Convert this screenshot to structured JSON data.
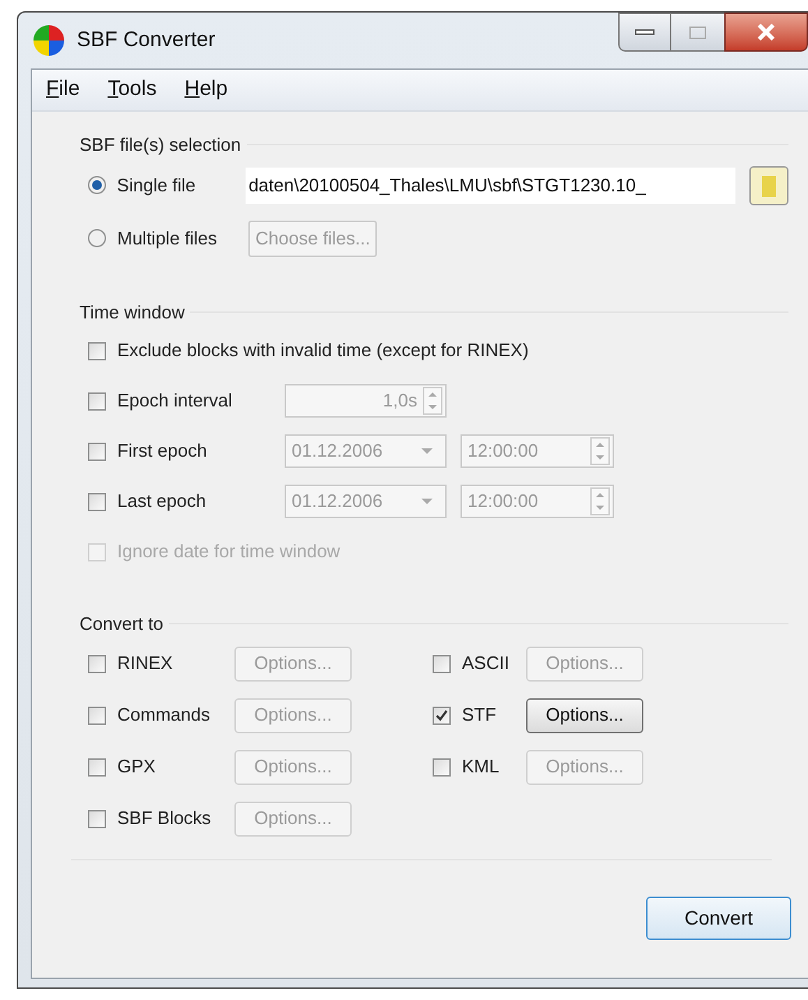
{
  "window": {
    "title": "SBF Converter"
  },
  "menu": [
    {
      "key": "F",
      "rest": "ile"
    },
    {
      "key": "T",
      "rest": "ools"
    },
    {
      "key": "H",
      "rest": "elp"
    }
  ],
  "file_selection": {
    "title": "SBF file(s) selection",
    "options": [
      {
        "label": "Single file",
        "selected": true,
        "kind": "path",
        "value": "daten\\20100504_Thales\\LMU\\sbf\\STGT1230.10_"
      },
      {
        "label": "Multiple files",
        "selected": false,
        "kind": "chooser",
        "button": "Choose files..."
      }
    ]
  },
  "time_window": {
    "title": "Time window",
    "rows": [
      {
        "kind": "plain",
        "label": "Exclude blocks with invalid time (except for RINEX)",
        "checked": false,
        "disabled": false
      },
      {
        "kind": "spin",
        "label": "Epoch interval",
        "checked": false,
        "disabled": false,
        "value": "1,0s"
      },
      {
        "kind": "datetime",
        "label": "First epoch",
        "checked": false,
        "disabled": false,
        "date": "01.12.2006",
        "time": "12:00:00"
      },
      {
        "kind": "datetime",
        "label": "Last epoch",
        "checked": false,
        "disabled": false,
        "date": "01.12.2006",
        "time": "12:00:00"
      },
      {
        "kind": "plain",
        "label": "Ignore date for time window",
        "checked": false,
        "disabled": true
      }
    ]
  },
  "convert_to": {
    "title": "Convert to",
    "left_formats": [
      {
        "label": "RINEX",
        "checked": false,
        "options": "Options..."
      },
      {
        "label": "Commands",
        "checked": false,
        "options": "Options..."
      },
      {
        "label": "GPX",
        "checked": false,
        "options": "Options..."
      },
      {
        "label": "SBF Blocks",
        "checked": false,
        "options": "Options..."
      }
    ],
    "right_formats": [
      {
        "label": "ASCII",
        "checked": false,
        "options": "Options..."
      },
      {
        "label": "STF",
        "checked": true,
        "options": "Options..."
      },
      {
        "label": "KML",
        "checked": false,
        "options": "Options..."
      }
    ]
  },
  "convert_button": "Convert"
}
